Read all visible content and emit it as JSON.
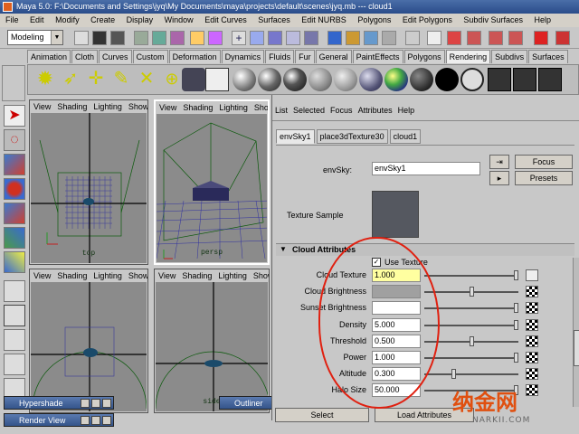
{
  "window": {
    "title": "Maya 5.0: F:\\Documents and Settings\\jyq\\My Documents\\maya\\projects\\default\\scenes\\jyq.mb    ---    cloud1"
  },
  "menubar": [
    "File",
    "Edit",
    "Modify",
    "Create",
    "Display",
    "Window",
    "Edit Curves",
    "Surfaces",
    "Edit NURBS",
    "Polygons",
    "Edit Polygons",
    "Subdiv Surfaces",
    "Help"
  ],
  "statusline": {
    "mode": "Modeling"
  },
  "shelf": {
    "tabs": [
      "Animation",
      "Cloth",
      "Curves",
      "Custom",
      "Deformation",
      "Dynamics",
      "Fluids",
      "Fur",
      "General",
      "PaintEffects",
      "Polygons",
      "Rendering",
      "Subdivs",
      "Surfaces"
    ],
    "active_tab": "Rendering"
  },
  "panel_menu": [
    "View",
    "Shading",
    "Lighting",
    "Show"
  ],
  "viewports": {
    "top": "top",
    "persp": "persp",
    "side": "side"
  },
  "attribute_editor": {
    "menu": [
      "List",
      "Selected",
      "Focus",
      "Attributes",
      "Help"
    ],
    "tabs": [
      "envSky1",
      "place3dTexture30",
      "cloud1"
    ],
    "active_tab": "envSky1",
    "node_label": "envSky:",
    "node_value": "envSky1",
    "focus_button": "Focus",
    "presets_button": "Presets",
    "texture_sample_label": "Texture Sample",
    "section_title": "Cloud Attributes",
    "use_texture_label": "Use Texture",
    "use_texture_checked": true,
    "rows": [
      {
        "label": "Cloud Texture",
        "value": "1.000",
        "kind": "field",
        "slider": 1.0
      },
      {
        "label": "Cloud Brightness",
        "value": "",
        "kind": "swatch",
        "swatch_color": "#a0a0a0",
        "slider": 0.5
      },
      {
        "label": "Sunset Brightness",
        "value": "",
        "kind": "swatch",
        "swatch_color": "#ffffff",
        "slider": 1.0
      },
      {
        "label": "Density",
        "value": "5.000",
        "kind": "field",
        "slider": 1.0
      },
      {
        "label": "Threshold",
        "value": "0.500",
        "kind": "field",
        "slider": 0.5
      },
      {
        "label": "Power",
        "value": "1.000",
        "kind": "field",
        "slider": 1.0
      },
      {
        "label": "Altitude",
        "value": "0.300",
        "kind": "field",
        "slider": 0.3
      },
      {
        "label": "Halo Size",
        "value": "50.000",
        "kind": "field",
        "slider": 1.0
      }
    ],
    "select_button": "Select",
    "load_attributes_button": "Load Attributes"
  },
  "floating_windows": {
    "hypershade": "Hypershade",
    "render_view": "Render View",
    "outliner": "Outliner"
  },
  "watermark": {
    "text": "纳金网",
    "site": "NARKII.COM"
  },
  "colors": {
    "annotation_circle": "#e02010",
    "title_bar": "#2a4c8a",
    "grid_green": "#0c5a0c"
  }
}
